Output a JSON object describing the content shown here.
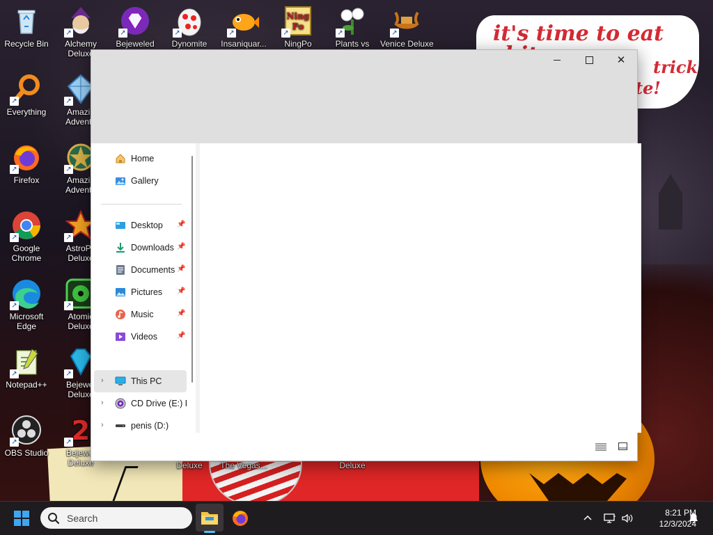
{
  "wallpaper": {
    "bubble_line1": "it's time to eat shit",
    "bubble_line2": "trick",
    "bubble_line3": "te!"
  },
  "desktop_icons": [
    {
      "label": "Recycle Bin",
      "icon": "recycle-bin-icon"
    },
    {
      "label": "Alchemy Deluxe",
      "icon": "alchemy-icon"
    },
    {
      "label": "Bejeweled",
      "icon": "bejeweled-icon"
    },
    {
      "label": "Dynomite",
      "icon": "dynomite-icon"
    },
    {
      "label": "Insaniquar...",
      "icon": "insaniquarium-icon"
    },
    {
      "label": "NingPo",
      "icon": "ningpo-icon"
    },
    {
      "label": "Plants vs",
      "icon": "plants-vs-zombies-icon"
    },
    {
      "label": "Venice Deluxe",
      "icon": "venice-icon"
    },
    {
      "label": "Everything",
      "icon": "everything-search-icon"
    },
    {
      "label": "Amazin Adventu",
      "icon": "amazing-adventures-icon"
    },
    {
      "label": "Firefox",
      "icon": "firefox-icon"
    },
    {
      "label": "Amazin Adventu",
      "icon": "amazing-adventures-2-icon"
    },
    {
      "label": "Google Chrome",
      "icon": "chrome-icon"
    },
    {
      "label": "AstroPo Deluxe",
      "icon": "astropop-icon"
    },
    {
      "label": "Microsoft Edge",
      "icon": "edge-icon"
    },
    {
      "label": "Atomic Deluxe",
      "icon": "atomica-icon"
    },
    {
      "label": "Notepad++",
      "icon": "notepad-plus-plus-icon"
    },
    {
      "label": "Bejewel Deluxe",
      "icon": "bejeweled-deluxe-icon"
    },
    {
      "label": "OBS Studio",
      "icon": "obs-icon"
    },
    {
      "label": "Bejewel Deluxe",
      "icon": "bejeweled-2-icon"
    },
    {
      "label": "Deluxe",
      "icon": "game-icon"
    },
    {
      "label": "The Vegas...",
      "icon": "vegas-icon"
    },
    {
      "label": "Deluxe",
      "icon": "game-icon"
    }
  ],
  "explorer": {
    "minimize_glyph": "",
    "close_glyph": "✕",
    "nav": {
      "home": "Home",
      "gallery": "Gallery",
      "desktop": "Desktop",
      "downloads": "Downloads",
      "documents": "Documents",
      "pictures": "Pictures",
      "music": "Music",
      "videos": "Videos",
      "this_pc": "This PC",
      "cd_drive": "CD Drive (E:) Po",
      "drive_d": "penis (D:)"
    }
  },
  "taskbar": {
    "search_placeholder": "Search",
    "time": "8:21 PM",
    "date": "12/3/2024"
  }
}
